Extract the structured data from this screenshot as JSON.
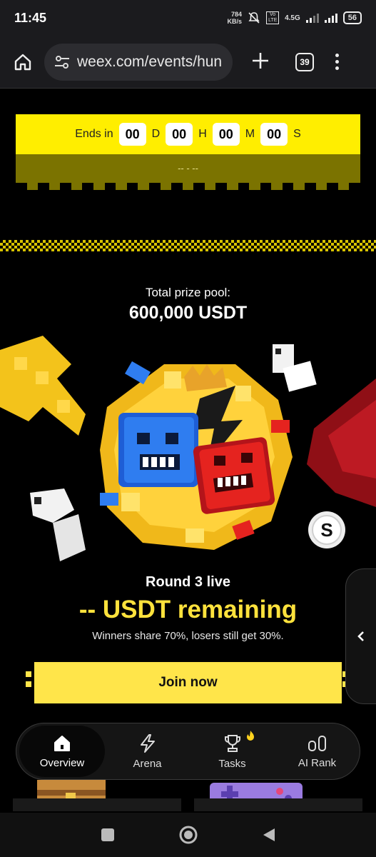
{
  "status_bar": {
    "time": "11:45",
    "speed_value": "784",
    "speed_unit": "KB/s",
    "volte": "Vo LTE",
    "network": "4.5G",
    "battery": "56"
  },
  "browser": {
    "url": "weex.com/events/hun",
    "tab_count": "39"
  },
  "countdown": {
    "label": "Ends in",
    "days": "00",
    "days_unit": "D",
    "hours": "00",
    "hours_unit": "H",
    "minutes": "00",
    "minutes_unit": "M",
    "seconds": "00",
    "seconds_unit": "S",
    "placeholder": "-- - --"
  },
  "prize": {
    "label": "Total prize pool:",
    "value": "600,000 USDT"
  },
  "round": {
    "title": "Round 3 live",
    "remaining": "-- USDT remaining",
    "subtitle": "Winners share 70%, losers still get 30%."
  },
  "cta": {
    "join_label": "Join now"
  },
  "bottom_nav": {
    "items": [
      {
        "label": "Overview",
        "icon": "home-icon"
      },
      {
        "label": "Arena",
        "icon": "lightning-icon"
      },
      {
        "label": "Tasks",
        "icon": "trophy-icon"
      },
      {
        "label": "AI Rank",
        "icon": "ai-rank-icon"
      }
    ]
  },
  "colors": {
    "accent_yellow": "#ffee00",
    "button_yellow": "#ffe54a",
    "background": "#000000",
    "blue_block": "#2f7df0",
    "red_block": "#e5231f"
  }
}
